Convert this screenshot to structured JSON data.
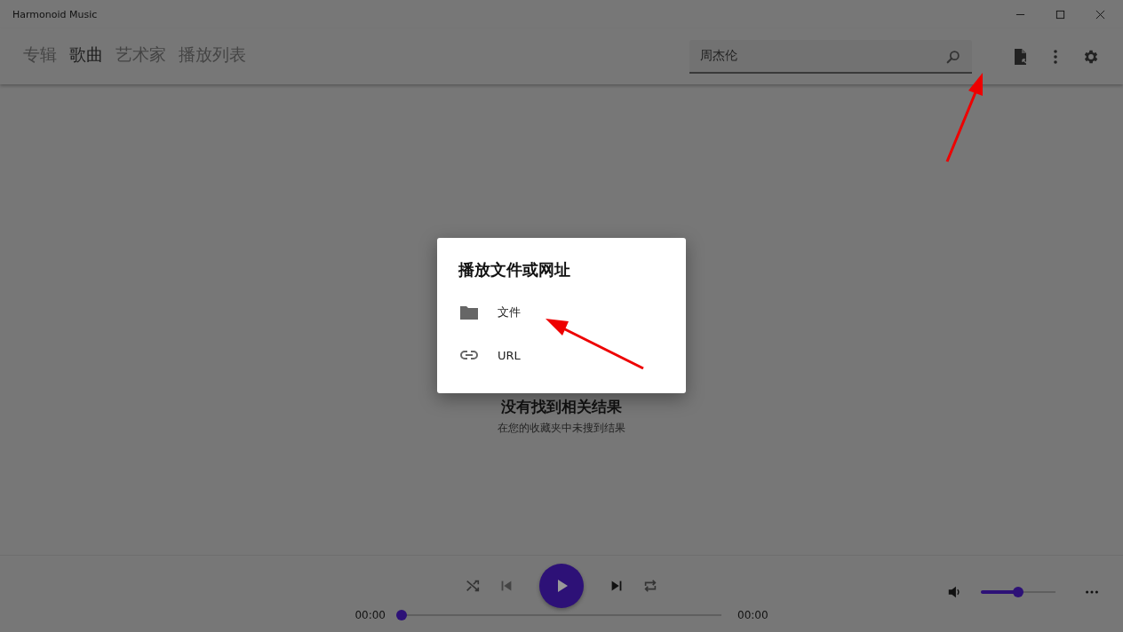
{
  "window": {
    "title": "Harmonoid Music"
  },
  "tabs": [
    {
      "label": "专辑",
      "selected": false
    },
    {
      "label": "歌曲",
      "selected": true
    },
    {
      "label": "艺术家",
      "selected": false
    },
    {
      "label": "播放列表",
      "selected": false
    }
  ],
  "search": {
    "value": "周杰伦"
  },
  "empty_state": {
    "title": "没有找到相关结果",
    "subtitle": "在您的收藏夹中未搜到结果"
  },
  "dialog": {
    "title": "播放文件或网址",
    "options": [
      {
        "kind": "file",
        "label": "文件"
      },
      {
        "kind": "url",
        "label": "URL"
      }
    ]
  },
  "player": {
    "position": "00:00",
    "duration": "00:00",
    "progress": {
      "level": 0
    },
    "volume": {
      "level": 0.5
    }
  }
}
